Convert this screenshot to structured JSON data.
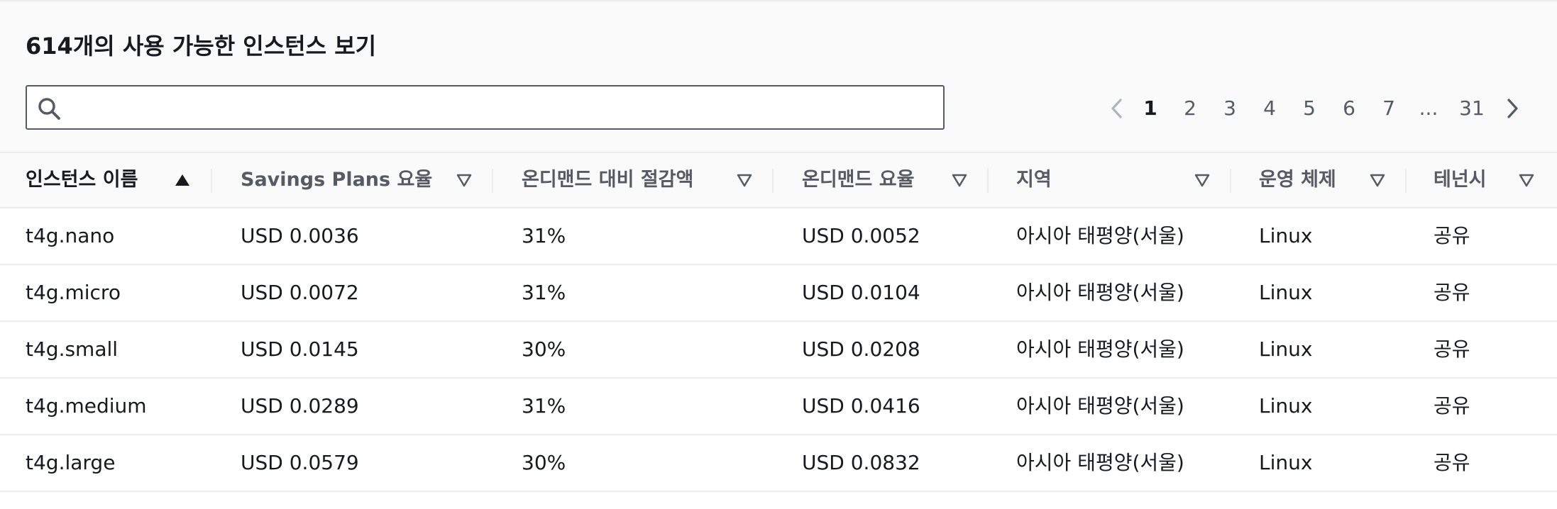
{
  "header": {
    "title": "614개의 사용 가능한 인스턴스 보기"
  },
  "search": {
    "value": "",
    "placeholder": "",
    "icon": "search-icon"
  },
  "pagination": {
    "prev_icon": "chevron-left-icon",
    "next_icon": "chevron-right-icon",
    "current": "1",
    "pages": [
      "1",
      "2",
      "3",
      "4",
      "5",
      "6",
      "7",
      "...",
      "31"
    ]
  },
  "table": {
    "columns": [
      {
        "label": "인스턴스 이름",
        "sort": "ascending"
      },
      {
        "label": "Savings Plans 요율",
        "sort": "none"
      },
      {
        "label": "온디맨드 대비 절감액",
        "sort": "none"
      },
      {
        "label": "온디맨드 요율",
        "sort": "none"
      },
      {
        "label": "지역",
        "sort": "none"
      },
      {
        "label": "운영 체제",
        "sort": "none"
      },
      {
        "label": "테넌시",
        "sort": "none"
      }
    ],
    "rows": [
      [
        "t4g.nano",
        "USD 0.0036",
        "31%",
        "USD 0.0052",
        "아시아 태평양(서울)",
        "Linux",
        "공유"
      ],
      [
        "t4g.micro",
        "USD 0.0072",
        "31%",
        "USD 0.0104",
        "아시아 태평양(서울)",
        "Linux",
        "공유"
      ],
      [
        "t4g.small",
        "USD 0.0145",
        "30%",
        "USD 0.0208",
        "아시아 태평양(서울)",
        "Linux",
        "공유"
      ],
      [
        "t4g.medium",
        "USD 0.0289",
        "31%",
        "USD 0.0416",
        "아시아 태평양(서울)",
        "Linux",
        "공유"
      ],
      [
        "t4g.large",
        "USD 0.0579",
        "30%",
        "USD 0.0832",
        "아시아 태평양(서울)",
        "Linux",
        "공유"
      ]
    ]
  },
  "colors": {
    "text": "#16191f",
    "muted": "#545b64",
    "border": "#eaeded",
    "header_bg": "#fafafa"
  }
}
